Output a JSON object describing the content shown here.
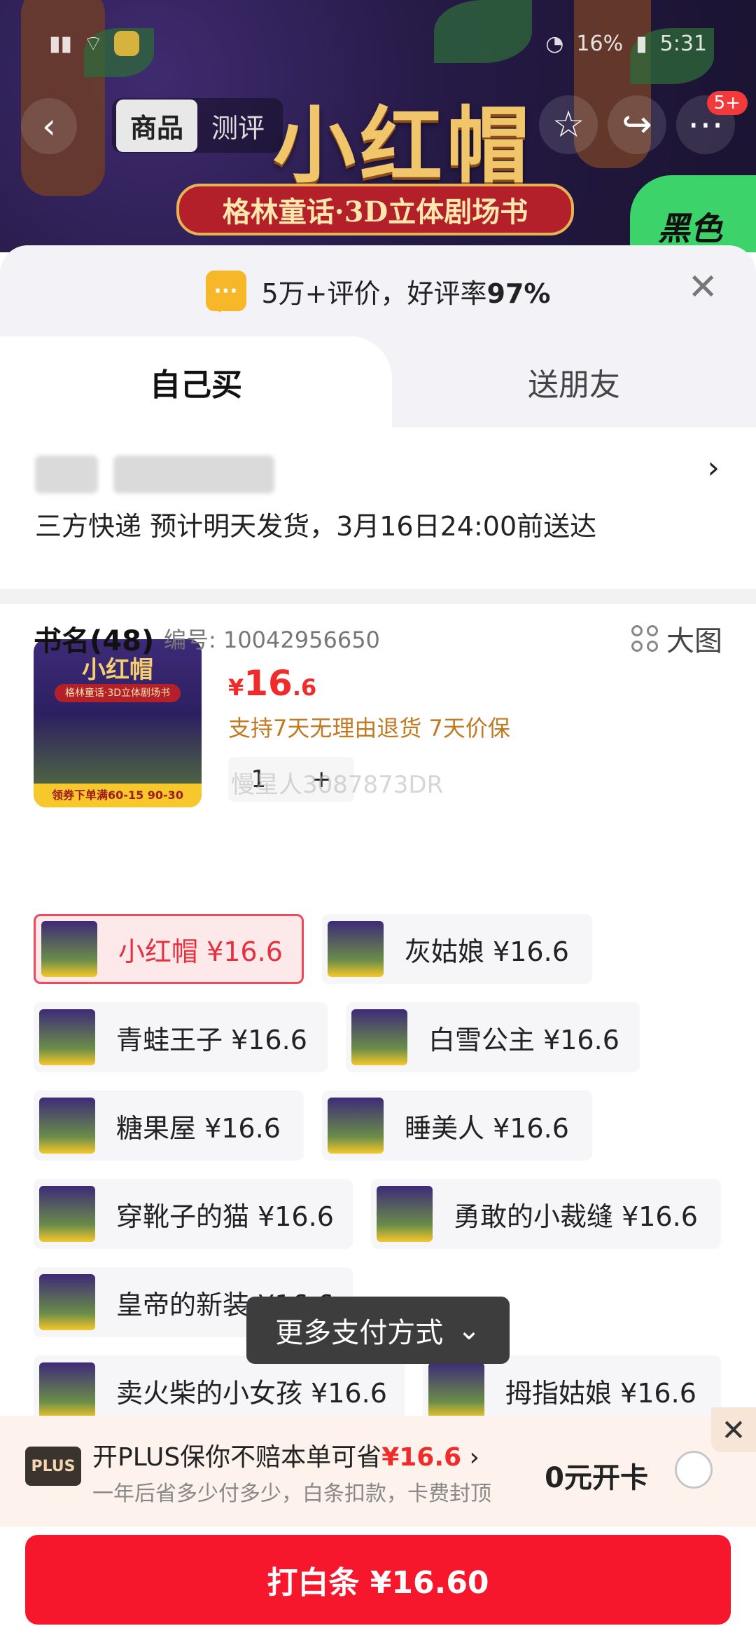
{
  "status_bar": {
    "time": "5:31",
    "battery": "16%"
  },
  "header": {
    "back_icon": "chevron-left-icon",
    "tabs": [
      {
        "label": "商品",
        "active": true
      },
      {
        "label": "测评",
        "active": false
      }
    ],
    "icons": [
      "star-icon",
      "share-icon",
      "more-icon"
    ],
    "badge": "5+"
  },
  "hero": {
    "title": "小红帽",
    "subtitle": "格林童话·3D立体剧场书",
    "tag": "黑色"
  },
  "sheet": {
    "rating_prefix": "5万+评价，好评率",
    "rating_value": "97%",
    "close_icon": "close-icon"
  },
  "purchase_tabs": {
    "self": "自己买",
    "friend": "送朋友"
  },
  "address": {
    "shipping": "三方快递 预计明天发货，3月16日24:00前送达",
    "chevron": "›"
  },
  "product": {
    "thumb_title": "小红帽",
    "thumb_subtitle": "格林童话·3D立体剧场书",
    "thumb_coupon": "领券下单满60-15 90-30",
    "price_currency": "¥",
    "price_int": "16",
    "price_dec": ".6",
    "guarantee": "支持7天无理由退货 7天价保",
    "quantity": "1",
    "plus": "+",
    "watermark": "慢星人3087873DR"
  },
  "spec": {
    "title": "书名(48)",
    "code": "编号: 10042956650",
    "bigview": "大图",
    "options": [
      {
        "label": "小红帽  ¥16.6",
        "selected": true
      },
      {
        "label": "灰姑娘  ¥16.6",
        "selected": false
      },
      {
        "label": "青蛙王子  ¥16.6",
        "selected": false
      },
      {
        "label": "白雪公主  ¥16.6",
        "selected": false
      },
      {
        "label": "糖果屋  ¥16.6",
        "selected": false
      },
      {
        "label": "睡美人  ¥16.6",
        "selected": false
      },
      {
        "label": "穿靴子的猫  ¥16.6",
        "selected": false
      },
      {
        "label": "勇敢的小裁缝  ¥16.6",
        "selected": false
      },
      {
        "label": "皇帝的新装  ¥16.6",
        "selected": false
      },
      {
        "label": "卖火柴的小女孩  ¥16.6",
        "selected": false
      },
      {
        "label": "拇指姑娘  ¥16.6",
        "selected": false
      }
    ]
  },
  "more_payment": {
    "label": "更多支付方式",
    "icon": "double-chevron-down-icon"
  },
  "plus_bar": {
    "logo": "PLUS",
    "main_prefix": "开PLUS保你不赔本单可省",
    "main_amount": "¥16.6",
    "main_suffix": "›",
    "sub": "一年后省多少付多少，白条扣款，卡费封顶",
    "zero_open": "0元开卡",
    "close": "✕"
  },
  "pay_button": {
    "label": "打白条 ¥16.60",
    "color": "#f7172c"
  }
}
